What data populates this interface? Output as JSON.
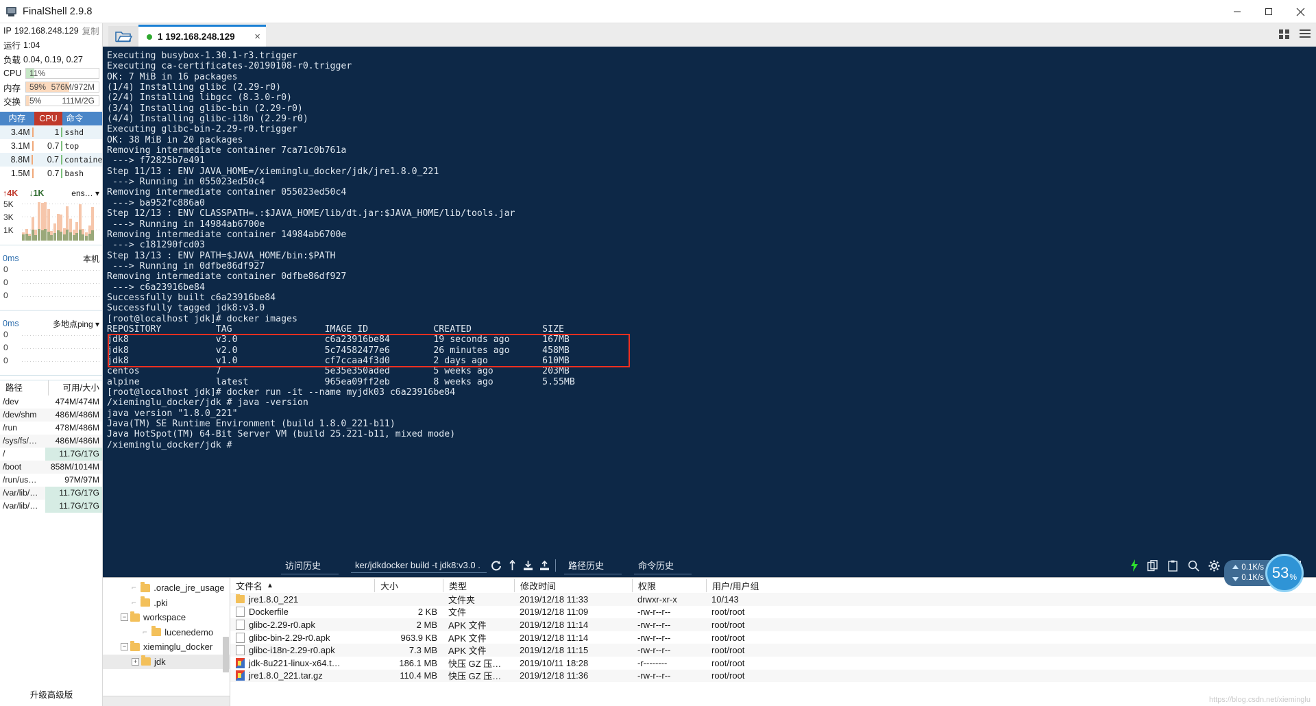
{
  "window": {
    "title": "FinalShell 2.9.8",
    "minimize": "minimize-icon",
    "maximize": "maximize-icon",
    "close": "close-icon"
  },
  "sidebar": {
    "ip_label": "IP",
    "ip_value": "192.168.248.129",
    "ip_copy": "复制",
    "uptime_label": "运行",
    "uptime_value": "1:04",
    "load_label": "负载",
    "load_value": "0.04, 0.19, 0.27",
    "meters": [
      {
        "name": "CPU",
        "percent": "11%",
        "detail": "",
        "fill": 11,
        "color": "#c6e6c6"
      },
      {
        "name": "内存",
        "percent": "59%",
        "detail": "576M/972M",
        "fill": 59,
        "color": "#fbd9bd"
      },
      {
        "name": "交换",
        "percent": "5%",
        "detail": "111M/2G",
        "fill": 5,
        "color": "#fbd9bd"
      }
    ],
    "proc_headers": [
      "内存",
      "CPU",
      "命令"
    ],
    "processes": [
      {
        "mem": "3.4M",
        "cpu": "1",
        "cmd": "sshd"
      },
      {
        "mem": "3.1M",
        "cpu": "0.7",
        "cmd": "top"
      },
      {
        "mem": "8.8M",
        "cpu": "0.7",
        "cmd": "container"
      },
      {
        "mem": "1.5M",
        "cpu": "0.7",
        "cmd": "bash"
      }
    ],
    "net_graph": {
      "up": "4K",
      "down": "1K",
      "iface": "ens…",
      "ticks": [
        "5K",
        "3K",
        "1K"
      ]
    },
    "ping_local": {
      "latency": "0ms",
      "label": "本机",
      "ticks": [
        "0",
        "0",
        "0"
      ]
    },
    "ping_multi": {
      "latency": "0ms",
      "label": "多地点ping",
      "ticks": [
        "0",
        "0",
        "0"
      ]
    },
    "disk_headers": [
      "路径",
      "可用/大小"
    ],
    "disks": [
      {
        "path": "/dev",
        "size": "474M/474M",
        "hl": false
      },
      {
        "path": "/dev/shm",
        "size": "486M/486M",
        "hl": false
      },
      {
        "path": "/run",
        "size": "478M/486M",
        "hl": false
      },
      {
        "path": "/sys/fs/…",
        "size": "486M/486M",
        "hl": false
      },
      {
        "path": "/",
        "size": "11.7G/17G",
        "hl": true
      },
      {
        "path": "/boot",
        "size": "858M/1014M",
        "hl": false
      },
      {
        "path": "/run/us…",
        "size": "97M/97M",
        "hl": false
      },
      {
        "path": "/var/lib/…",
        "size": "11.7G/17G",
        "hl": true
      },
      {
        "path": "/var/lib/…",
        "size": "11.7G/17G",
        "hl": true
      }
    ],
    "upgrade": "升级高级版"
  },
  "tabs": {
    "folder_icon": "open-folder-icon",
    "active": {
      "label": "1 192.168.248.129",
      "status": "connected",
      "close": "×"
    },
    "right_icons": [
      "grid-view-icon",
      "list-view-icon"
    ]
  },
  "terminal": {
    "lines": [
      "Executing busybox-1.30.1-r3.trigger",
      "Executing ca-certificates-20190108-r0.trigger",
      "OK: 7 MiB in 16 packages",
      "(1/4) Installing glibc (2.29-r0)",
      "(2/4) Installing libgcc (8.3.0-r0)",
      "(3/4) Installing glibc-bin (2.29-r0)",
      "(4/4) Installing glibc-i18n (2.29-r0)",
      "Executing glibc-bin-2.29-r0.trigger",
      "OK: 38 MiB in 20 packages",
      "Removing intermediate container 7ca71c0b761a",
      " ---> f72825b7e491",
      "Step 11/13 : ENV JAVA_HOME=/xieminglu_docker/jdk/jre1.8.0_221",
      " ---> Running in 055023ed50c4",
      "Removing intermediate container 055023ed50c4",
      " ---> ba952fc886a0",
      "Step 12/13 : ENV CLASSPATH=.:$JAVA_HOME/lib/dt.jar:$JAVA_HOME/lib/tools.jar",
      " ---> Running in 14984ab6700e",
      "Removing intermediate container 14984ab6700e",
      " ---> c181290fcd03",
      "Step 13/13 : ENV PATH=$JAVA_HOME/bin:$PATH",
      " ---> Running in 0dfbe86df927",
      "Removing intermediate container 0dfbe86df927",
      " ---> c6a23916be84",
      "Successfully built c6a23916be84",
      "Successfully tagged jdk8:v3.0",
      "[root@localhost jdk]# docker images",
      "REPOSITORY          TAG                 IMAGE ID            CREATED             SIZE",
      "jdk8                v3.0                c6a23916be84        19 seconds ago      167MB",
      "jdk8                v2.0                5c74582477e6        26 minutes ago      458MB",
      "jdk8                v1.0                cf7ccaa4f3d0        2 days ago          610MB",
      "centos              7                   5e35e350aded        5 weeks ago         203MB",
      "alpine              latest              965ea09ff2eb        8 weeks ago         5.55MB",
      "[root@localhost jdk]# docker run -it --name myjdk03 c6a23916be84",
      "/xieminglu_docker/jdk # java -version",
      "java version \"1.8.0_221\"",
      "Java(TM) SE Runtime Environment (build 1.8.0_221-b11)",
      "Java HotSpot(TM) 64-Bit Server VM (build 25.221-b11, mixed mode)",
      "/xieminglu_docker/jdk # "
    ],
    "highlight_color": "#ef2f1f"
  },
  "cmdbar": {
    "visit_history": "访问历史",
    "command_value": "ker/jdkdocker build -t jdk8:v3.0 .",
    "icons": [
      "refresh-icon",
      "upload-arrow-icon",
      "download-tray-icon",
      "upload-tray-icon"
    ],
    "path_history": "路径历史",
    "command_history": "命令历史",
    "right_icons": [
      "lightning-icon",
      "copy-icon",
      "paste-icon",
      "search-icon",
      "gear-icon",
      "open-folder-icon",
      "play-icon",
      "download-icon",
      "window-icon"
    ]
  },
  "tree": {
    "nodes": [
      {
        "label": ".oracle_jre_usage",
        "depth": 2,
        "expander": "",
        "selected": false
      },
      {
        "label": ".pki",
        "depth": 2,
        "expander": "",
        "selected": false
      },
      {
        "label": "workspace",
        "depth": 1,
        "expander": "−",
        "selected": false
      },
      {
        "label": "lucenedemo",
        "depth": 3,
        "expander": "",
        "selected": false
      },
      {
        "label": "xieminglu_docker",
        "depth": 1,
        "expander": "−",
        "selected": false
      },
      {
        "label": "jdk",
        "depth": 2,
        "expander": "+",
        "selected": true
      }
    ]
  },
  "filelist": {
    "headers": [
      "文件名",
      "大小",
      "类型",
      "修改时间",
      "权限",
      "用户/用户组"
    ],
    "sort_arrow": "▲",
    "rows": [
      {
        "icon": "folder-icon",
        "name": "jre1.8.0_221",
        "size": "",
        "type": "文件夹",
        "time": "2019/12/18 11:33",
        "perm": "drwxr-xr-x",
        "owner": "10/143"
      },
      {
        "icon": "file-icon",
        "name": "Dockerfile",
        "size": "2 KB",
        "type": "文件",
        "time": "2019/12/18 11:09",
        "perm": "-rw-r--r--",
        "owner": "root/root"
      },
      {
        "icon": "file-icon",
        "name": "glibc-2.29-r0.apk",
        "size": "2 MB",
        "type": "APK 文件",
        "time": "2019/12/18 11:14",
        "perm": "-rw-r--r--",
        "owner": "root/root"
      },
      {
        "icon": "file-icon",
        "name": "glibc-bin-2.29-r0.apk",
        "size": "963.9 KB",
        "type": "APK 文件",
        "time": "2019/12/18 11:14",
        "perm": "-rw-r--r--",
        "owner": "root/root"
      },
      {
        "icon": "file-icon",
        "name": "glibc-i18n-2.29-r0.apk",
        "size": "7.3 MB",
        "type": "APK 文件",
        "time": "2019/12/18 11:15",
        "perm": "-rw-r--r--",
        "owner": "root/root"
      },
      {
        "icon": "zip-icon",
        "name": "jdk-8u221-linux-x64.t…",
        "size": "186.1 MB",
        "type": "快压 GZ 压…",
        "time": "2019/10/11 18:28",
        "perm": "-r--------",
        "owner": "root/root"
      },
      {
        "icon": "zip-icon",
        "name": "jre1.8.0_221.tar.gz",
        "size": "110.4 MB",
        "type": "快压 GZ 压…",
        "time": "2019/12/18 11:36",
        "perm": "-rw-r--r--",
        "owner": "root/root"
      }
    ]
  },
  "speed_widget": {
    "up": "0.1K/s",
    "down": "0.1K/s",
    "value": "53",
    "unit": "%"
  },
  "watermark": "https://blog.csdn.net/xieminglu"
}
